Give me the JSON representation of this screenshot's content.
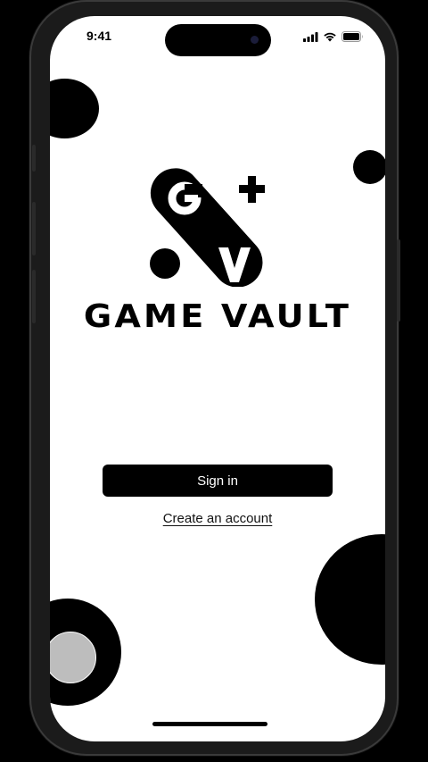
{
  "status_bar": {
    "time": "9:41",
    "icons": [
      "cellular-signal-icon",
      "wifi-icon",
      "battery-icon"
    ]
  },
  "logo": {
    "letters": [
      "G",
      "V"
    ],
    "brand": "GAME VAULT"
  },
  "actions": {
    "sign_in_label": "Sign in",
    "create_account_label": "Create an account"
  },
  "colors": {
    "background": "#ffffff",
    "primary": "#000000",
    "button_text": "#ffffff",
    "assistive_touch": "#bdbdbd"
  }
}
